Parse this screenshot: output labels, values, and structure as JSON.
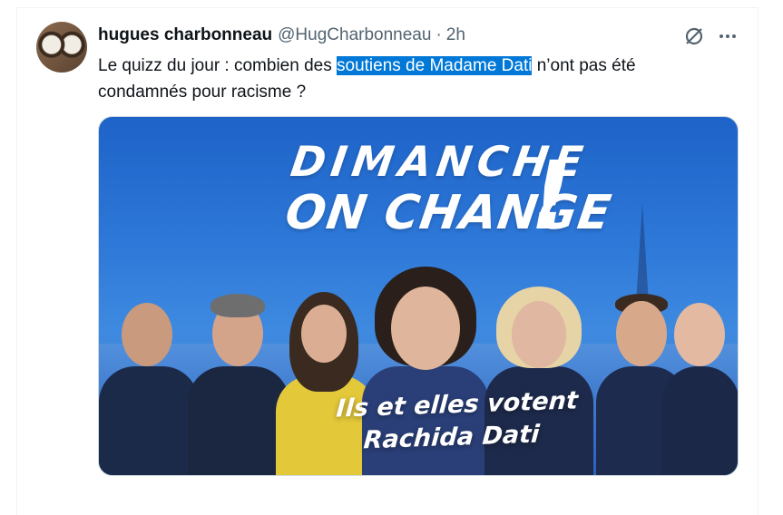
{
  "tweet": {
    "author_name": "hugues charbonneau",
    "author_handle": "@HugCharbonneau",
    "separator": "·",
    "time": "2h",
    "text_before": "Le quizz du jour : combien des ",
    "text_highlight": "soutiens de Madame Dati",
    "text_after": " n’ont pas été condamnés pour racisme ?",
    "icons": {
      "avatar": "avatar-image",
      "grok": "grok-icon",
      "more": "more-icon"
    }
  },
  "media": {
    "headline_line1": "DIMANCHE",
    "headline_line2": "ON CHANGE",
    "headline_exclamation": "!",
    "tagline_line1": "Ils et elles votent",
    "tagline_line2": "Rachida Dati",
    "colors": {
      "background": "#2d78d8",
      "text": "#ffffff",
      "highlight": "#0078d7"
    }
  }
}
